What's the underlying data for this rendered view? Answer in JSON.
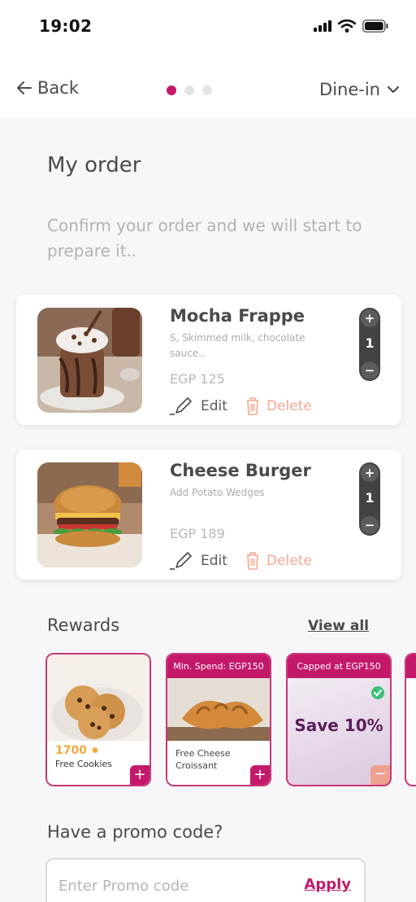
{
  "status": {
    "time": "19:02"
  },
  "nav": {
    "back_label": "Back",
    "mode_label": "Dine-in",
    "steps_total": 3,
    "steps_active": 1
  },
  "page": {
    "title": "My order",
    "subtitle": "Confirm your order and we will start to prepare it.."
  },
  "order_items": [
    {
      "name": "Mocha Frappe",
      "description": "S, Skimmed milk, chocolate sauce..",
      "price": "EGP 125",
      "quantity": "1",
      "edit_label": "Edit",
      "delete_label": "Delete"
    },
    {
      "name": "Cheese Burger",
      "description": "Add Potato Wedges",
      "price": "EGP 189",
      "quantity": "1",
      "edit_label": "Edit",
      "delete_label": "Delete"
    }
  ],
  "stepper": {
    "plus": "+",
    "minus": "−"
  },
  "rewards": {
    "title": "Rewards",
    "view_all": "View all",
    "cards": [
      {
        "points": "1700",
        "name": "Free Cookies"
      },
      {
        "banner": "Min. Spend: EGP150",
        "name": "Free Cheese Croissant"
      },
      {
        "banner": "Capped at EGP150",
        "title": "Save 10%"
      }
    ]
  },
  "promo": {
    "title": "Have a promo code?",
    "placeholder": "Enter Promo code",
    "apply_label": "Apply"
  },
  "colors": {
    "accent": "#c4196a",
    "delete": "#f3a890",
    "points": "#f2a93b"
  }
}
